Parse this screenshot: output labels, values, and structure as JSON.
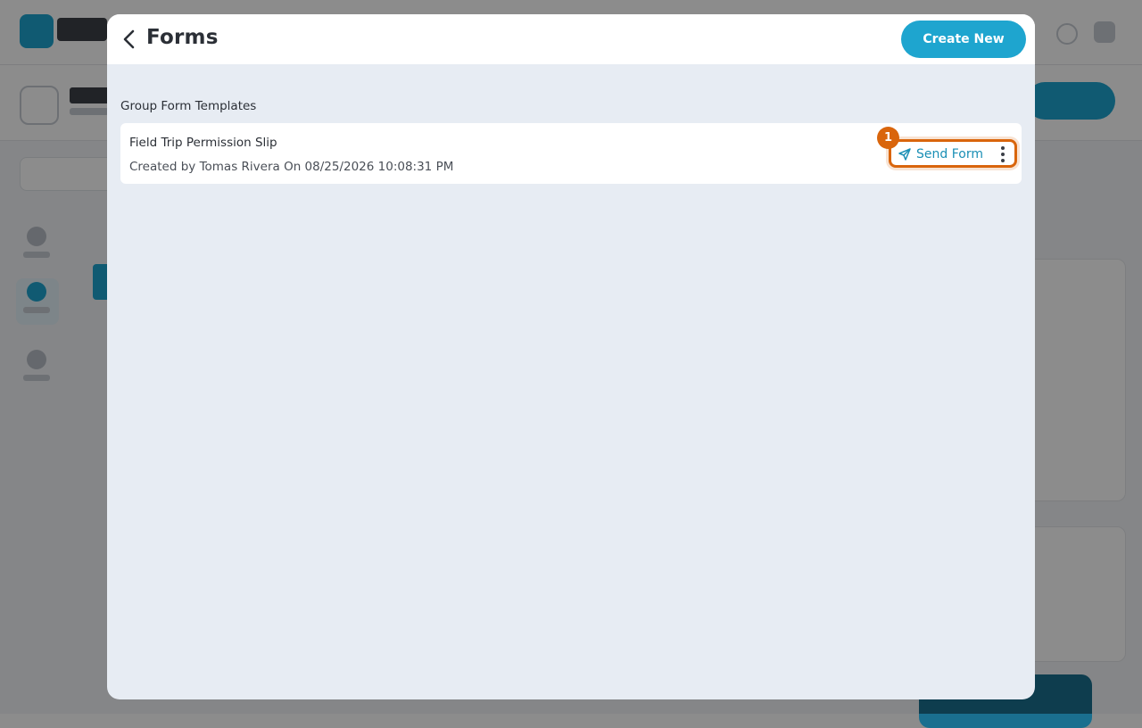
{
  "modal": {
    "title": "Forms",
    "create_new_label": "Create New",
    "section_label": "Group Form Templates"
  },
  "templates": [
    {
      "name": "Field Trip Permission Slip",
      "meta": "Created by Tomas Rivera On 08/25/2026 10:08:31 PM",
      "send_label": "Send Form"
    }
  ],
  "annotation": {
    "step_number": "1"
  },
  "icons": {
    "back": "chevron-left-icon",
    "send": "paper-plane-icon",
    "more": "more-vertical-icon"
  },
  "colors": {
    "accent": "#1ea5cf",
    "highlight": "#d9650c",
    "modal_background": "#e7ecf3"
  }
}
